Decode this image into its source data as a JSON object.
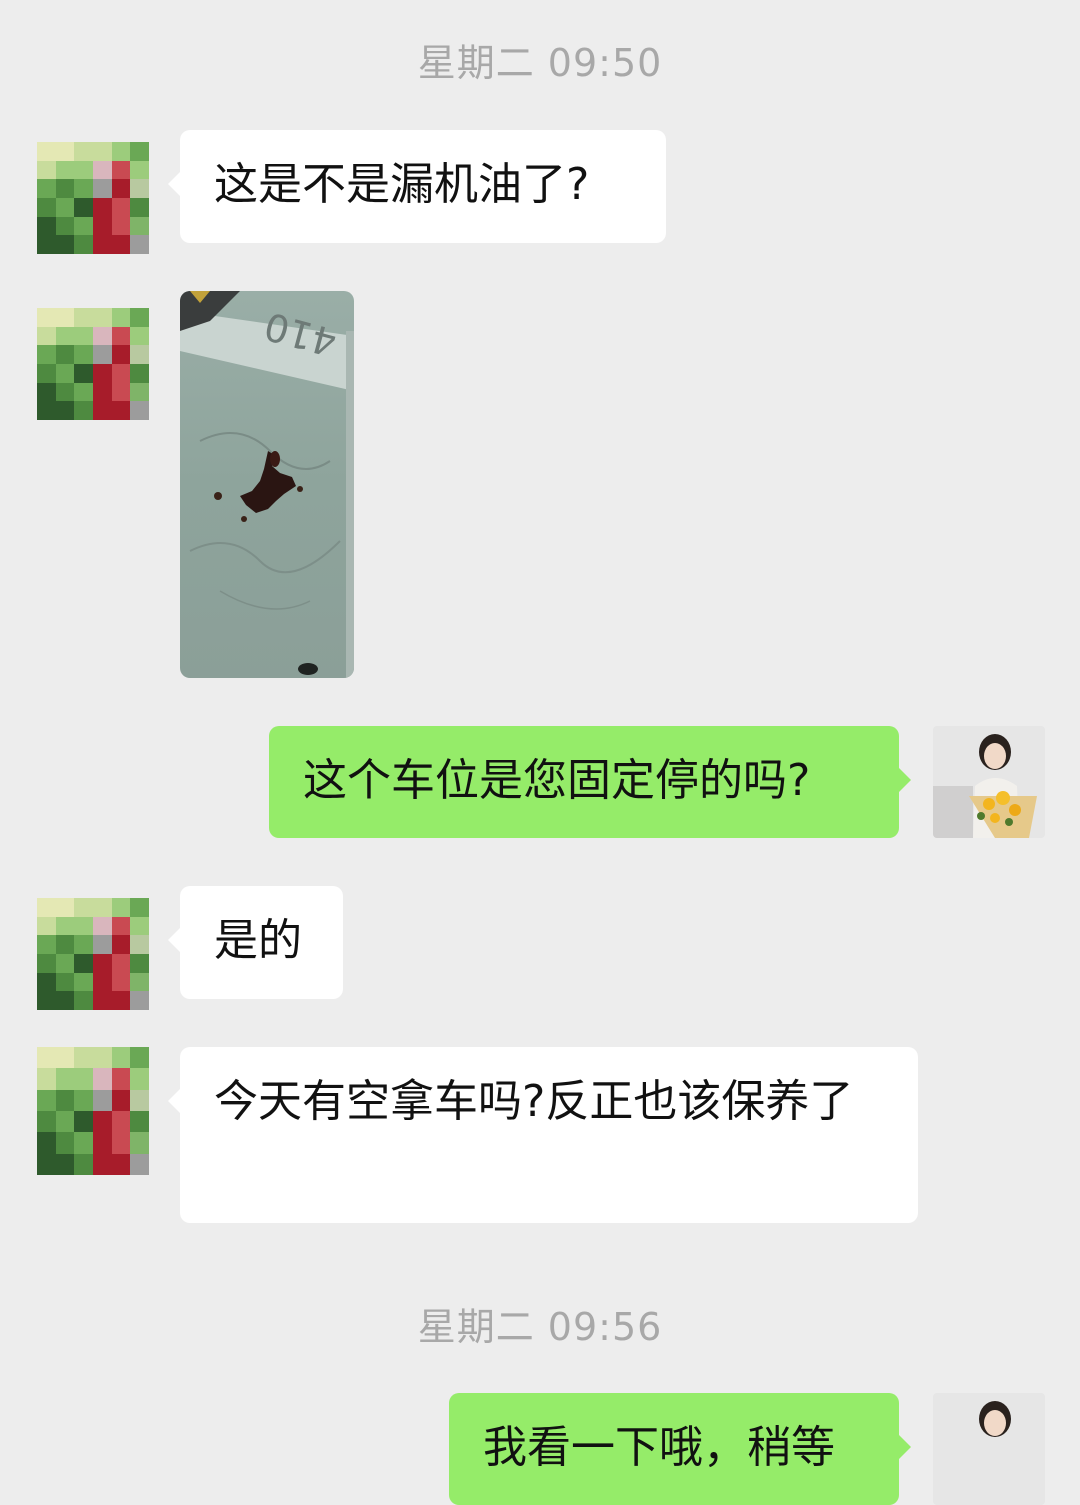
{
  "chat": {
    "timestamps": [
      "星期二 09:50",
      "星期二 09:56"
    ],
    "messages": [
      {
        "side": "in",
        "type": "text",
        "text": "这是不是漏机油了?"
      },
      {
        "side": "in",
        "type": "image",
        "image_text": "410"
      },
      {
        "side": "out",
        "type": "text",
        "text": "这个车位是您固定停的吗?"
      },
      {
        "side": "in",
        "type": "text",
        "text": "是的"
      },
      {
        "side": "in",
        "type": "text",
        "text": "今天有空拿车吗?反正也该保养了"
      },
      {
        "side": "out",
        "type": "text",
        "text": "我看一下哦，稍等"
      }
    ]
  },
  "colors": {
    "background": "#ededed",
    "incoming_bubble": "#ffffff",
    "outgoing_bubble": "#95ec69",
    "timestamp_text": "#a8a8a8"
  },
  "icons": {
    "contact_avatar": "pixelated-avatar-icon",
    "self_avatar": "person-with-flowers-avatar"
  }
}
